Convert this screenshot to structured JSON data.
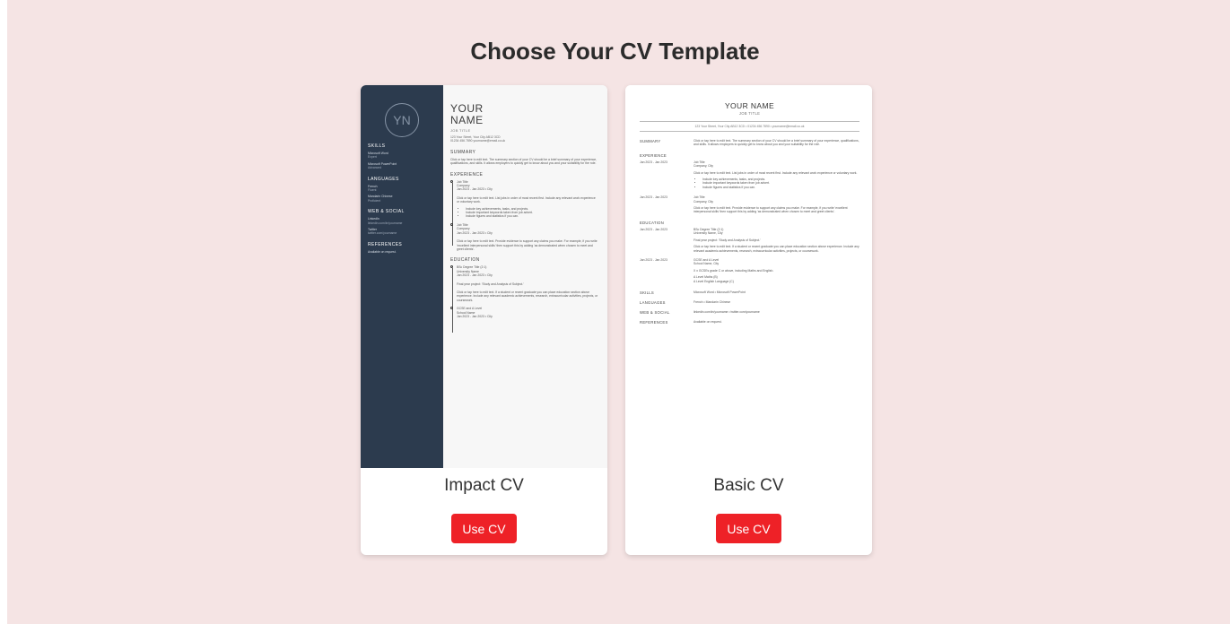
{
  "page": {
    "title": "Choose Your CV Template"
  },
  "templates": [
    {
      "name": "Impact CV",
      "button_label": "Use CV"
    },
    {
      "name": "Basic CV",
      "button_label": "Use CV"
    }
  ],
  "impact_preview": {
    "initials": "YN",
    "name_line1": "YOUR",
    "name_line2": "NAME",
    "job_title": "JOB TITLE",
    "address": "123 Your Street, Your City AB12 3CD",
    "contact": "01234 456 7890   yourname@email.co.uk",
    "sidebar": {
      "skills_heading": "SKILLS",
      "skill1": "Microsoft Word",
      "skill1_level": "Expert",
      "skill2": "Microsoft PowerPoint",
      "skill2_level": "Advanced",
      "languages_heading": "LANGUAGES",
      "lang1": "French",
      "lang1_level": "Fluent",
      "lang2": "Mandarin Chinese",
      "lang2_level": "Proficient",
      "web_heading": "WEB & SOCIAL",
      "web1": "LinkedIn",
      "web1_value": "linkedin.com/in/yourname",
      "web2": "Twitter",
      "web2_value": "twitter.com/yourname",
      "references_heading": "REFERENCES",
      "references_text": "Available on request."
    },
    "summary_heading": "SUMMARY",
    "summary_text": "Click or tap here to edit text. The summary section of your CV should be a brief summary of your experience, qualifications, and skills. It allows employers to quickly get to know about you and your suitability for the role.",
    "experience_heading": "EXPERIENCE",
    "job1_title": "Job Title",
    "job1_company": "Company",
    "job1_dates": "Jan 2023 - Jan 2023 • City",
    "job1_text": "Click or tap here to edit text. List jobs in order of most recent first. Include any relevant work experience or voluntary work.",
    "job1_bullet1": "Include key achievements, tasks, and projects.",
    "job1_bullet2": "Include important keywords taken from job advert.",
    "job1_bullet3": "Include figures and statistics if you can.",
    "job2_title": "Job Title",
    "job2_company": "Company",
    "job2_dates": "Jan 2023 - Jan 2023 • City",
    "job2_text": "Click or tap here to edit text. Provide evidence to support any claims you make. For example, if you write 'excellent interpersonal skills' then support this by adding 'as demonstrated when chosen to meet and greet clients'.",
    "education_heading": "EDUCATION",
    "edu1_title": "BSc Degree Title (2:1)",
    "edu1_school": "University Name",
    "edu1_dates": "Jan 2023 - Jan 2023 • City",
    "edu1_project": "Final year project: 'Study and Analysis of Subject.'",
    "edu1_text": "Click or tap here to edit text. If a student or recent graduate you can place education section above experience. Include any relevant academic achievements, research, extracurricular activities, projects, or coursework.",
    "edu2_title": "GCSE and A Level",
    "edu2_school": "School Name",
    "edu2_dates": "Jan 2023 - Jan 2023 • City"
  },
  "basic_preview": {
    "name": "YOUR NAME",
    "job_title": "JOB TITLE",
    "contact": "123 Your Street, Your City AB12 3CD • 01234 456 7890 • yourname@email.co.uk",
    "summary_label": "SUMMARY",
    "summary_text": "Click or tap here to edit text. The summary section of your CV should be a brief summary of your experience, qualifications, and skills. It allows employers to quickly get to know about you and your suitability for the role.",
    "experience_heading": "EXPERIENCE",
    "job1_dates": "Jan 2023 - Jan 2023",
    "job1_title": "Job Title",
    "job1_company": "Company, City",
    "job1_text": "Click or tap here to edit text. List jobs in order of most recent first. Include any relevant work experience or voluntary work.",
    "job1_bullet1": "Include key achievements, tasks, and projects.",
    "job1_bullet2": "Include important keywords taken from job advert.",
    "job1_bullet3": "Include figures and statistics if you can.",
    "job2_dates": "Jan 2023 - Jan 2023",
    "job2_title": "Job Title",
    "job2_company": "Company, City",
    "job2_text": "Click or tap here to edit text. Provide evidence to support any claims you make. For example, if you write 'excellent interpersonal skills' then support this by adding 'as demonstrated when chosen to meet and greet clients'.",
    "education_heading": "EDUCATION",
    "edu1_dates": "Jan 2023 - Jan 2023",
    "edu1_title": "BSc Degree Title (2:1)",
    "edu1_school": "University Name, City",
    "edu1_project": "Final year project: 'Study and Analysis of Subject.'",
    "edu1_text": "Click or tap here to edit text. If a student or recent graduate you can place education section above experience. Include any relevant academic achievements, research, extracurricular activities, projects, or coursework.",
    "edu2_dates": "Jan 2023 - Jan 2023",
    "edu2_title": "GCSE and A Level",
    "edu2_school": "School Name, City",
    "edu2_line1": "X x GCSEs grade C or above, including Maths and English.",
    "edu2_line2": "A Level Maths (B)",
    "edu2_line3": "A Level English Language (C)",
    "skills_label": "SKILLS",
    "skills_text": "Microsoft Word • Microsoft PowerPoint",
    "languages_label": "LANGUAGES",
    "languages_text": "French • Mandarin Chinese",
    "web_label": "WEB & SOCIAL",
    "web_text": "linkedin.com/in/yourname • twitter.com/yourname",
    "references_label": "REFERENCES",
    "references_text": "Available on request."
  }
}
